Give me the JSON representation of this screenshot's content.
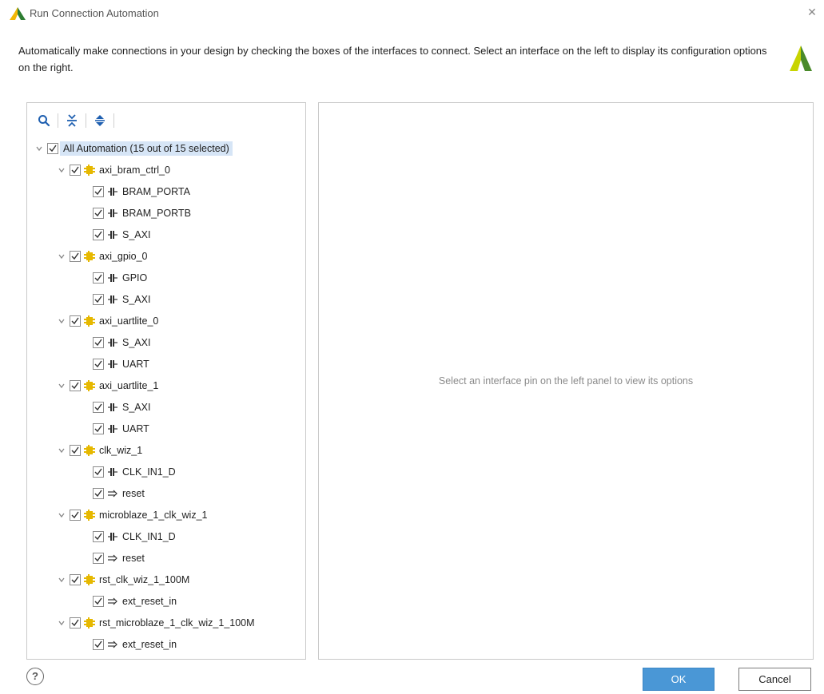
{
  "window": {
    "title": "Run Connection Automation",
    "close_glyph": "✕"
  },
  "description": "Automatically make connections in your design by checking the boxes of the interfaces to connect. Select an interface on the left to display its configuration options on the right.",
  "toolbar": {
    "icons": [
      "search-icon",
      "collapse-all-icon",
      "expand-all-icon"
    ]
  },
  "tree": {
    "root": {
      "label": "All Automation (15 out of 15 selected)",
      "checked": true,
      "expanded": true
    },
    "groups": [
      {
        "label": "axi_bram_ctrl_0",
        "checked": true,
        "expanded": true,
        "children": [
          {
            "label": "BRAM_PORTA",
            "type": "interface",
            "checked": true
          },
          {
            "label": "BRAM_PORTB",
            "type": "interface",
            "checked": true
          },
          {
            "label": "S_AXI",
            "type": "interface",
            "checked": true
          }
        ]
      },
      {
        "label": "axi_gpio_0",
        "checked": true,
        "expanded": true,
        "children": [
          {
            "label": "GPIO",
            "type": "interface",
            "checked": true
          },
          {
            "label": "S_AXI",
            "type": "interface",
            "checked": true
          }
        ]
      },
      {
        "label": "axi_uartlite_0",
        "checked": true,
        "expanded": true,
        "children": [
          {
            "label": "S_AXI",
            "type": "interface",
            "checked": true
          },
          {
            "label": "UART",
            "type": "interface",
            "checked": true
          }
        ]
      },
      {
        "label": "axi_uartlite_1",
        "checked": true,
        "expanded": true,
        "children": [
          {
            "label": "S_AXI",
            "type": "interface",
            "checked": true
          },
          {
            "label": "UART",
            "type": "interface",
            "checked": true
          }
        ]
      },
      {
        "label": "clk_wiz_1",
        "checked": true,
        "expanded": true,
        "children": [
          {
            "label": "CLK_IN1_D",
            "type": "interface",
            "checked": true
          },
          {
            "label": "reset",
            "type": "pin",
            "checked": true
          }
        ]
      },
      {
        "label": "microblaze_1_clk_wiz_1",
        "checked": true,
        "expanded": true,
        "children": [
          {
            "label": "CLK_IN1_D",
            "type": "interface",
            "checked": true
          },
          {
            "label": "reset",
            "type": "pin",
            "checked": true
          }
        ]
      },
      {
        "label": "rst_clk_wiz_1_100M",
        "checked": true,
        "expanded": true,
        "children": [
          {
            "label": "ext_reset_in",
            "type": "pin",
            "checked": true
          }
        ]
      },
      {
        "label": "rst_microblaze_1_clk_wiz_1_100M",
        "checked": true,
        "expanded": true,
        "children": [
          {
            "label": "ext_reset_in",
            "type": "pin",
            "checked": true
          }
        ]
      }
    ]
  },
  "right_panel": {
    "message": "Select an interface pin on the left panel to view its options"
  },
  "footer": {
    "help_glyph": "?",
    "ok_label": "OK",
    "cancel_label": "Cancel"
  },
  "colors": {
    "accent_ok": "#4a97d6",
    "selection": "#d6e5f6",
    "ip_icon": "#e6b800",
    "brand_yellow": "#c8d400",
    "brand_green": "#4a8a2a"
  }
}
